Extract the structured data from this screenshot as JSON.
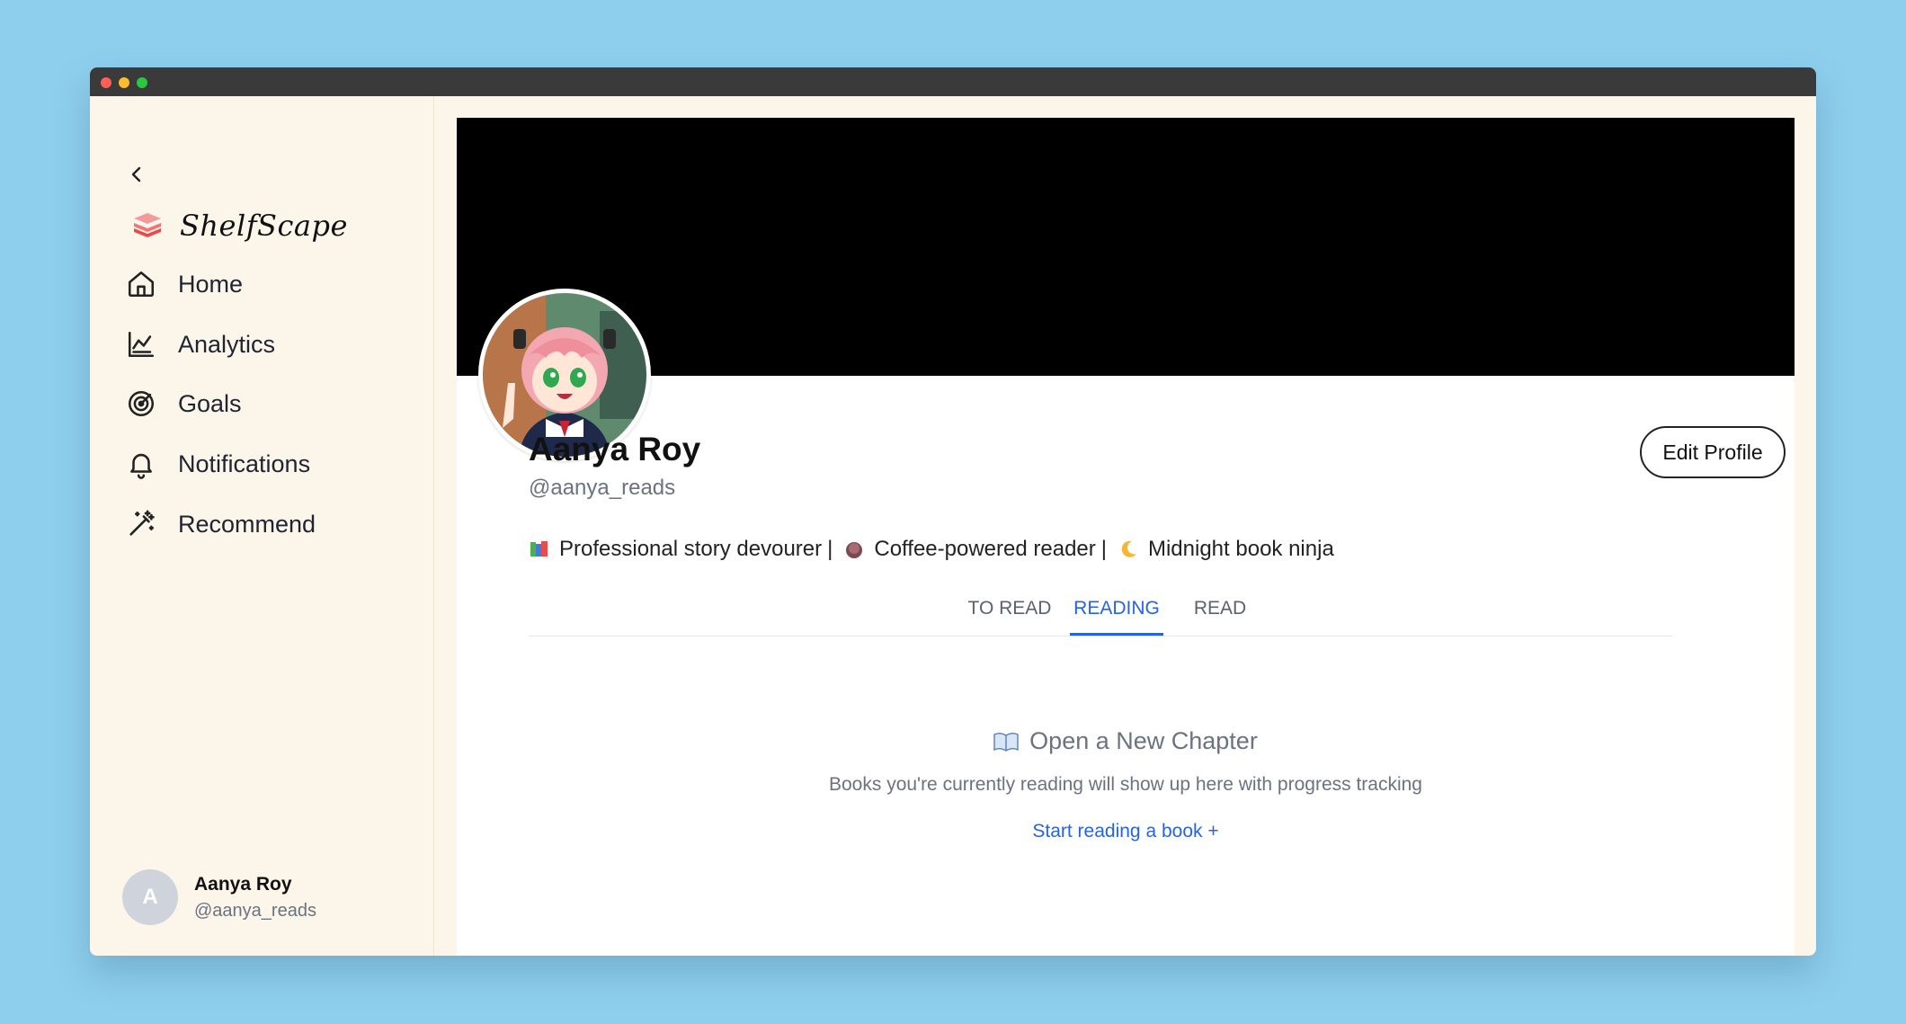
{
  "app": {
    "name": "ShelfScape"
  },
  "sidebar": {
    "nav": [
      {
        "label": "Home",
        "icon": "home-icon"
      },
      {
        "label": "Analytics",
        "icon": "chart-icon"
      },
      {
        "label": "Goals",
        "icon": "target-icon"
      },
      {
        "label": "Notifications",
        "icon": "bell-icon"
      },
      {
        "label": "Recommend",
        "icon": "magic-wand-icon"
      }
    ],
    "user": {
      "initial": "A",
      "name": "Aanya Roy",
      "handle": "@aanya_reads"
    }
  },
  "profile": {
    "name": "Aanya Roy",
    "handle": "@aanya_reads",
    "edit_label": "Edit Profile",
    "bio": [
      {
        "icon": "books-emoji",
        "text": "Professional story devourer"
      },
      {
        "icon": "coffee-emoji",
        "text": "Coffee-powered reader"
      },
      {
        "icon": "moon-emoji",
        "text": "Midnight book ninja"
      }
    ],
    "bio_separator": "|"
  },
  "tabs": [
    {
      "label": "TO READ",
      "active": false
    },
    {
      "label": "READING",
      "active": true
    },
    {
      "label": "READ",
      "active": false
    }
  ],
  "empty_state": {
    "title": "Open a New Chapter",
    "subtitle": "Books you're currently reading will show up here with progress tracking",
    "link": "Start reading a book +"
  },
  "colors": {
    "accent": "#2563eb",
    "sidebar_bg": "#fcf5ea",
    "banner": "#000000",
    "logo": "#ee5a5a"
  }
}
